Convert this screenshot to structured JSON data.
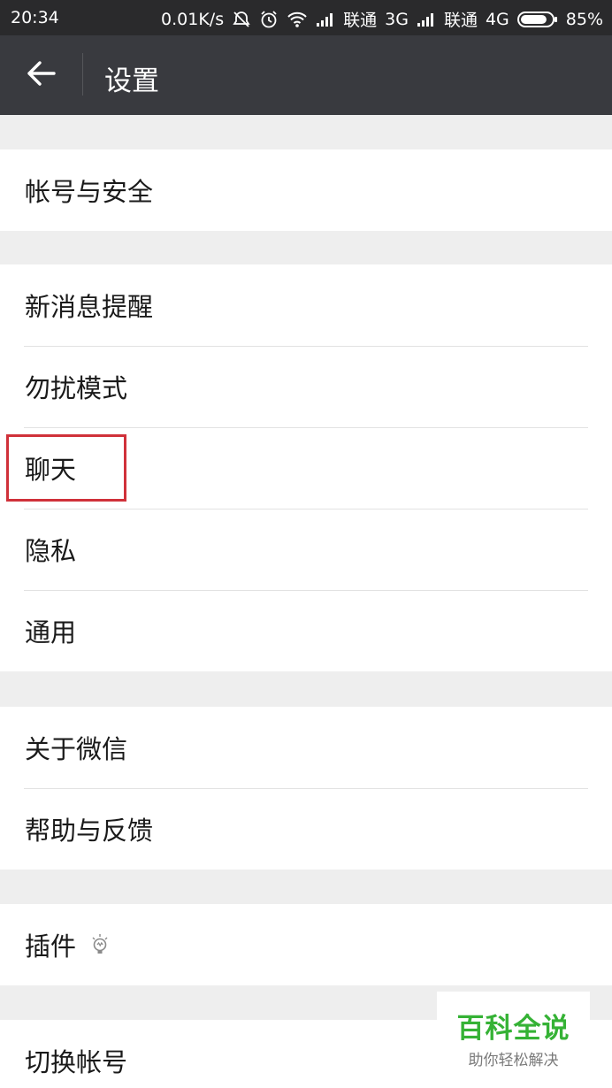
{
  "status_bar": {
    "time": "20:34",
    "net_speed": "0.01K/s",
    "carrier1": "联通",
    "network1": "3G",
    "carrier2": "联通",
    "network2": "4G",
    "battery": "85%",
    "battery_level": 0.85
  },
  "app_bar": {
    "title": "设置"
  },
  "settings": {
    "account_security": "帐号与安全",
    "new_message_alerts": "新消息提醒",
    "do_not_disturb": "勿扰模式",
    "chat": "聊天",
    "privacy": "隐私",
    "general": "通用",
    "about_wechat": "关于微信",
    "help_feedback": "帮助与反馈",
    "plugins": "插件",
    "switch_account": "切换帐号"
  },
  "watermark": {
    "title": "百科全说",
    "subtitle": "助你轻松解决"
  },
  "colors": {
    "status_bar": "#2a2a2c",
    "app_bar": "#393a3f",
    "background": "#eeeeee",
    "highlight": "#d0313a",
    "watermark_green": "#35b235"
  }
}
